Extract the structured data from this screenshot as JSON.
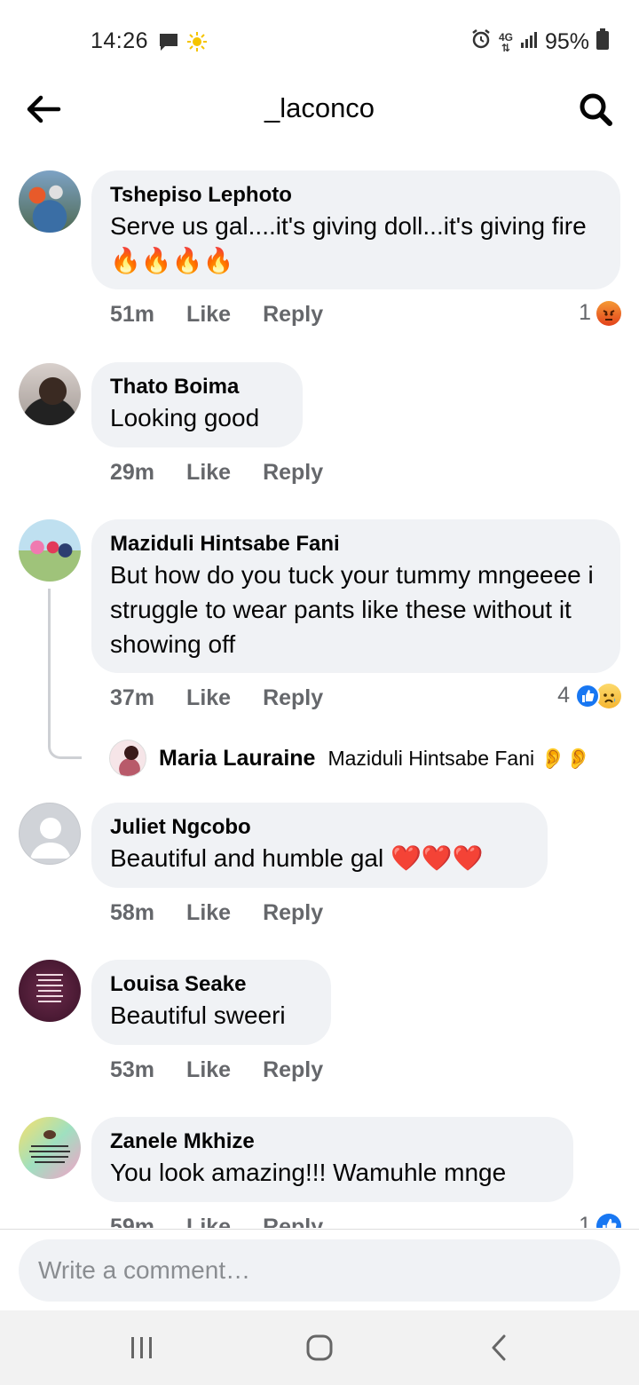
{
  "status_bar": {
    "time": "14:26",
    "network": "4G",
    "battery": "95%"
  },
  "header": {
    "title": "_laconco"
  },
  "comments": [
    {
      "author": "Tshepiso Lephoto",
      "text": "Serve us gal....it's giving doll...it's giving fire🔥🔥🔥🔥",
      "time": "51m",
      "like": "Like",
      "reply": "Reply",
      "reaction_count": "1",
      "reactions": [
        "angry"
      ]
    },
    {
      "author": "Thato Boima",
      "text": "Looking good",
      "time": "29m",
      "like": "Like",
      "reply": "Reply"
    },
    {
      "author": "Maziduli Hintsabe Fani",
      "text": "But how do you tuck your tummy mngeeee i struggle to wear pants like these without it showing off",
      "time": "37m",
      "like": "Like",
      "reply": "Reply",
      "reaction_count": "4",
      "reactions": [
        "like",
        "sad"
      ],
      "reply_preview": {
        "author": "Maria Lauraine",
        "text": "Maziduli Hintsabe Fani 👂👂"
      }
    },
    {
      "author": "Juliet Ngcobo",
      "text": "Beautiful and humble gal ❤️❤️❤️",
      "time": "58m",
      "like": "Like",
      "reply": "Reply"
    },
    {
      "author": "Louisa Seake",
      "text": "Beautiful sweeri",
      "time": "53m",
      "like": "Like",
      "reply": "Reply"
    },
    {
      "author": "Zanele Mkhize",
      "text": "You look amazing!!! Wamuhle mnge",
      "time": "59m",
      "like": "Like",
      "reply": "Reply",
      "reaction_count": "1",
      "reactions": [
        "like"
      ]
    }
  ],
  "composer": {
    "placeholder": "Write a comment…"
  },
  "colors": {
    "bubble": "#f0f2f5",
    "secondary_text": "#65676b",
    "like_blue": "#1877f2"
  }
}
